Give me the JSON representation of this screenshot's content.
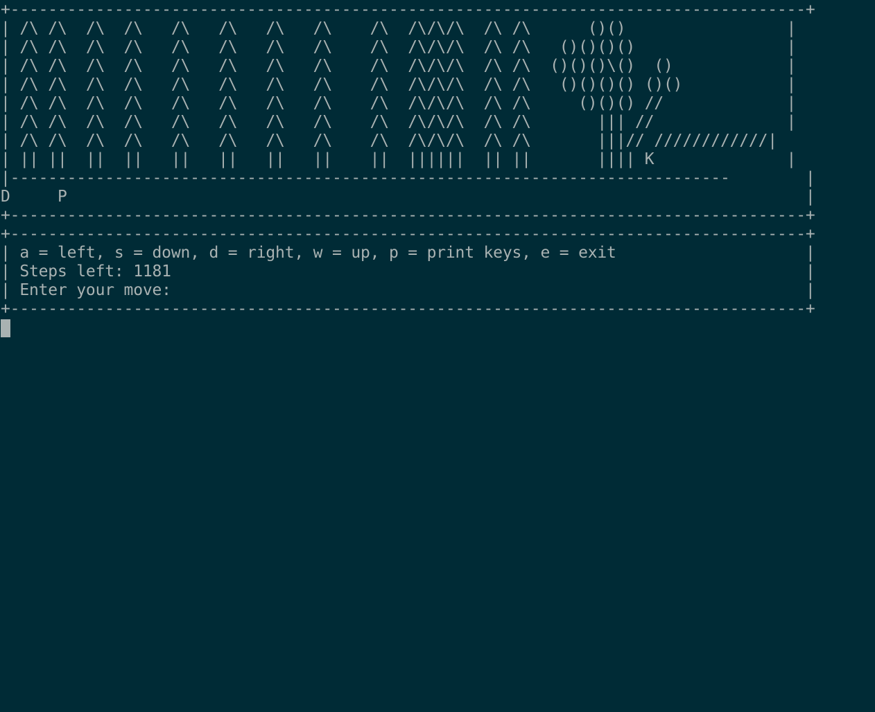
{
  "game_box": {
    "lines": [
      "+------------------------------------------------------------------------------------+",
      "| /\\ /\\  /\\  /\\   /\\   /\\   /\\   /\\    /\\  /\\/\\/\\  /\\ /\\      ()()                 |",
      "| /\\ /\\  /\\  /\\   /\\   /\\   /\\   /\\    /\\  /\\/\\/\\  /\\ /\\   ()()()()                |",
      "| /\\ /\\  /\\  /\\   /\\   /\\   /\\   /\\    /\\  /\\/\\/\\  /\\ /\\  ()()()\\()  ()            |",
      "| /\\ /\\  /\\  /\\   /\\   /\\   /\\   /\\    /\\  /\\/\\/\\  /\\ /\\   ()()()() ()()           |",
      "| /\\ /\\  /\\  /\\   /\\   /\\   /\\   /\\    /\\  /\\/\\/\\  /\\ /\\     ()()() //             |",
      "| /\\ /\\  /\\  /\\   /\\   /\\   /\\   /\\    /\\  /\\/\\/\\  /\\ /\\       ||| //              |",
      "| /\\ /\\  /\\  /\\   /\\   /\\   /\\   /\\    /\\  /\\/\\/\\  /\\ /\\       |||// ////////////|",
      "| || ||  ||  ||   ||   ||   ||   ||    ||  ||||||  || ||       |||| K              |",
      "|----------------------------------------------------------------------------        |",
      "D     P                                                                              |",
      "+------------------------------------------------------------------------------------+"
    ]
  },
  "control_box": {
    "border_top": "+------------------------------------------------------------------------------------+",
    "help": "| a = left, s = down, d = right, w = up, p = print keys, e = exit                    |",
    "steps": "| Steps left: 1181                                                                   |",
    "prompt": "| Enter your move:                                                                   |",
    "border_bottom": "+------------------------------------------------------------------------------------+"
  },
  "theme": {
    "background": "#002b36",
    "foreground": "#a9b2b2"
  }
}
